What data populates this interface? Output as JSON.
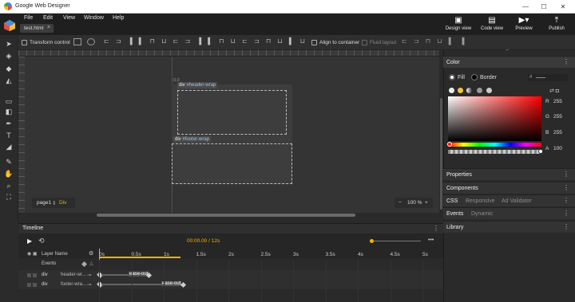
{
  "titlebar": {
    "title": "Google Web Designer",
    "minimize": "—",
    "maximize": "☐",
    "close": "✕"
  },
  "menu": [
    "File",
    "Edit",
    "View",
    "Window",
    "Help"
  ],
  "doc_tab": {
    "label": "test.html",
    "close": "×"
  },
  "app_tools": {
    "design_view": "Design view",
    "code_view": "Code view",
    "preview": "Preview",
    "publish": "Publish"
  },
  "toolbar": {
    "transform_control": "Transform control",
    "align_to_container": "Align to container",
    "fluid_layout": "Fluid layout"
  },
  "stage": {
    "header_label_tag": "div",
    "header_label_id": "#header-wrap",
    "footer_label_tag": "div",
    "footer_label_id": "#footer-wrap",
    "page_name": "page1",
    "page_sep": "⇕",
    "element_type": "Div",
    "zoom_minus": "−",
    "zoom_value": "100 %",
    "zoom_plus": "+",
    "ruler_marker": "0,0"
  },
  "color_panel": {
    "title": "Color",
    "fill": "Fill",
    "border": "Border",
    "hex": "#",
    "r_label": "R",
    "r_value": "255",
    "g_label": "G",
    "g_value": "255",
    "b_label": "B",
    "b_value": "255",
    "a_label": "A",
    "a_value": "100",
    "picker_color": "#ff0000"
  },
  "sections": {
    "properties": "Properties",
    "components": "Components",
    "css": "CSS",
    "responsive": "Responsive",
    "ad_validator": "Ad Validator",
    "events": "Events",
    "dynamic": "Dynamic",
    "library": "Library",
    "more": "⋮"
  },
  "timeline": {
    "title": "Timeline",
    "time": "00:00.00 / 12s",
    "layer_name": "Layer Name",
    "events": "Events",
    "ticks": [
      "0s",
      "0.5s",
      "1s",
      "1.5s",
      "2s",
      "2.5s",
      "3s",
      "3.5s",
      "4s",
      "4.5s",
      "5s"
    ],
    "rows": [
      {
        "type": "div",
        "name": "header-wr...",
        "easing": "ease-out"
      },
      {
        "type": "div",
        "name": "footer-wra...",
        "easing": "ease-out"
      }
    ]
  }
}
